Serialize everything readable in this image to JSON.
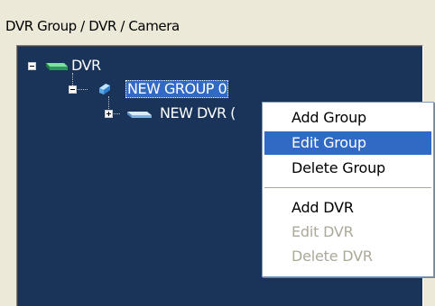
{
  "panel": {
    "title": "DVR Group / DVR / Camera"
  },
  "tree": {
    "root": {
      "label": "DVR",
      "icon": "dvr-root-icon",
      "expanded": true
    },
    "group": {
      "label": "NEW GROUP 0",
      "icon": "group-icon",
      "selected": true
    },
    "dvr": {
      "label": "NEW DVR (",
      "icon": "dvr-device-icon",
      "expanded": false
    }
  },
  "context_menu": {
    "items": [
      {
        "label": "Add Group",
        "state": "normal"
      },
      {
        "label": "Edit Group",
        "state": "highlighted"
      },
      {
        "label": "Delete Group",
        "state": "normal"
      },
      {
        "label": "Add DVR",
        "state": "normal"
      },
      {
        "label": "Edit DVR",
        "state": "disabled"
      },
      {
        "label": "Delete DVR",
        "state": "disabled"
      }
    ]
  },
  "colors": {
    "tree_background": "#1a3358",
    "selection": "#316ac5",
    "disabled_text": "#aca899",
    "dvr_icon_green": "#3cb878"
  }
}
